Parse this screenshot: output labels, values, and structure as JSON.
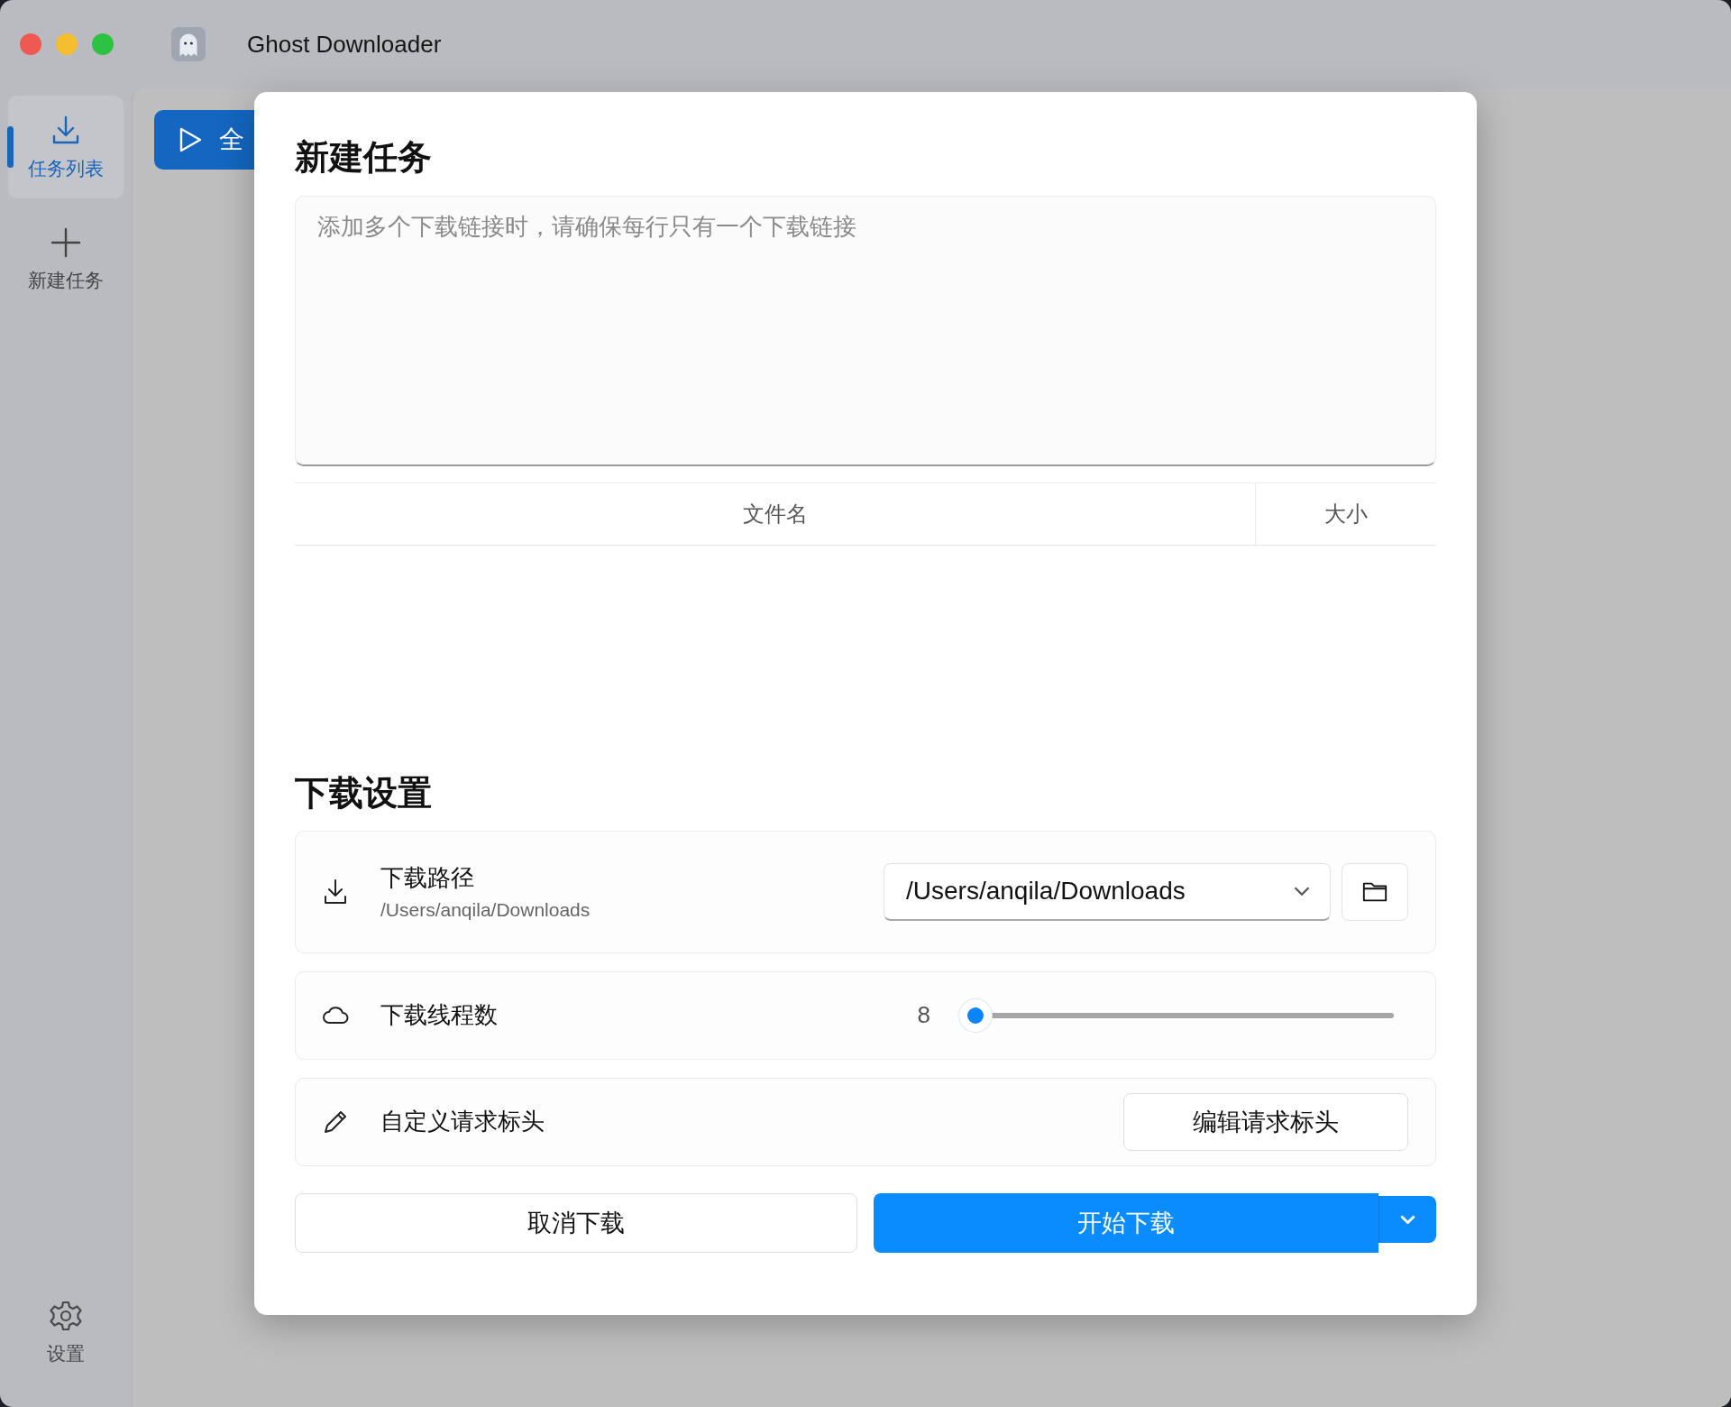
{
  "window": {
    "title": "Ghost Downloader"
  },
  "sidebar": {
    "items": [
      {
        "label": "任务列表",
        "selected": true
      },
      {
        "label": "新建任务",
        "selected": false
      }
    ],
    "footer_item": {
      "label": "设置"
    }
  },
  "toolbar": {
    "button": "全"
  },
  "dialog": {
    "title": "新建任务",
    "links_field": {
      "placeholder": "添加多个下载链接时，请确保每行只有一个下载链接"
    },
    "table": {
      "columns": [
        "文件名",
        "大小"
      ]
    },
    "settings_title": "下载设置",
    "settings": [
      {
        "kind": "path",
        "label": "下载路径",
        "subtitle": "/Users/anqila/Downloads",
        "value": "/Users/anqila/Downloads"
      },
      {
        "kind": "slider",
        "label": "下载线程数",
        "reading": "8",
        "level": 0
      },
      {
        "kind": "action",
        "label": "自定义请求标头",
        "button": "编辑请求标头"
      }
    ],
    "buttons": {
      "cancel": "取消下载",
      "primary": "开始下载"
    }
  }
}
